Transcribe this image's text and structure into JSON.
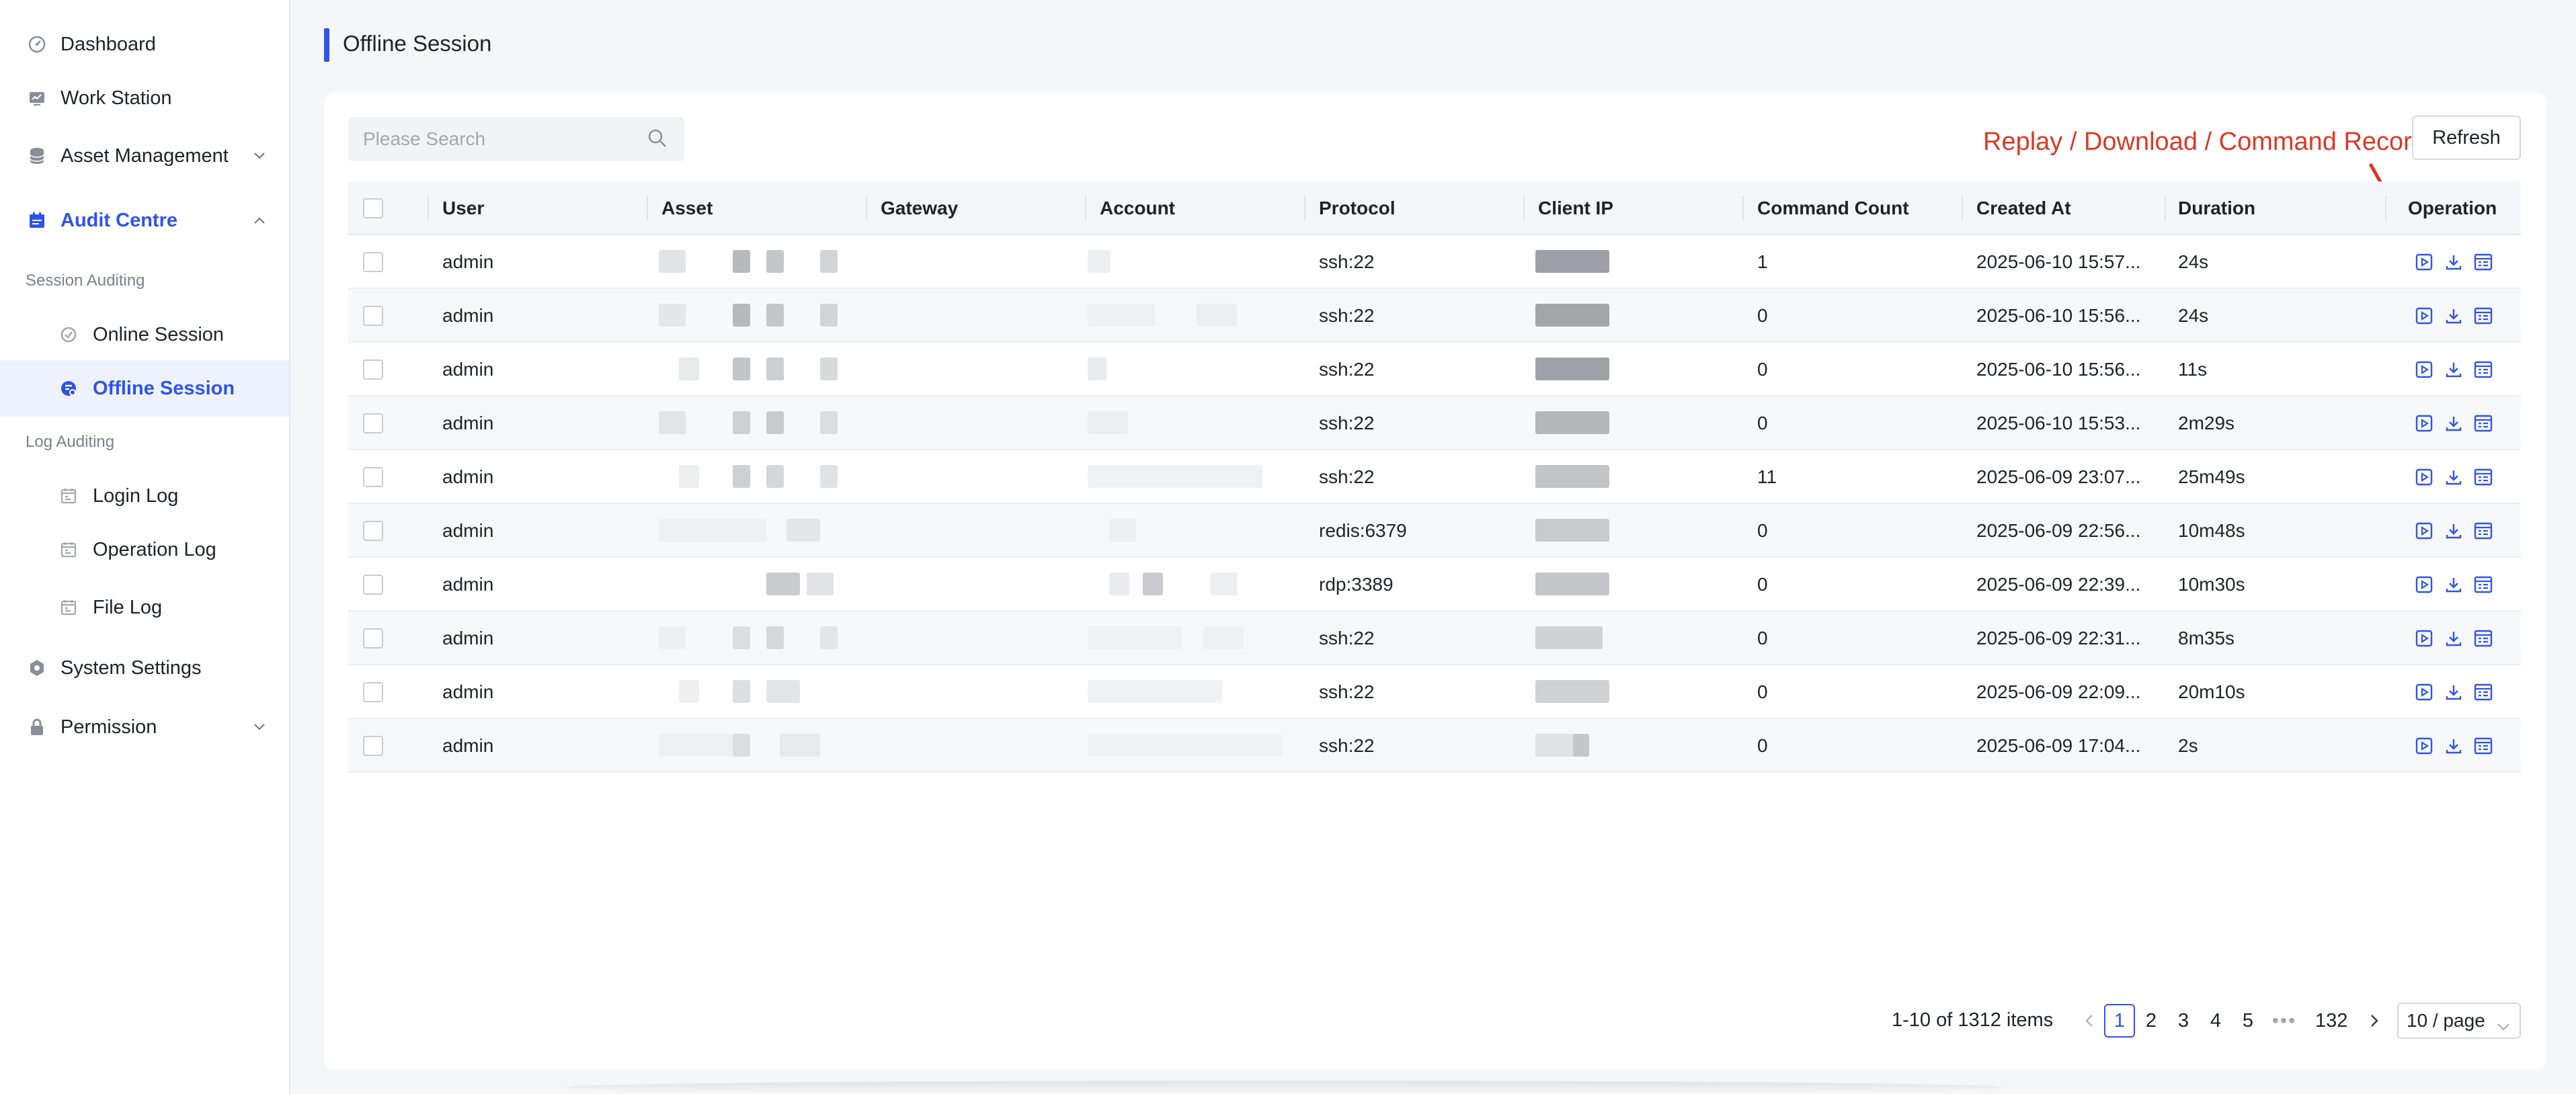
{
  "sidebar": {
    "items": [
      {
        "label": "Dashboard",
        "icon": "dashboard-icon"
      },
      {
        "label": "Work Station",
        "icon": "monitor-icon"
      },
      {
        "label": "Asset Management",
        "icon": "database-icon"
      },
      {
        "label": "Audit Centre",
        "icon": "calendar-icon"
      },
      {
        "label": "System Settings",
        "icon": "gear-icon"
      },
      {
        "label": "Permission",
        "icon": "lock-icon"
      }
    ],
    "groups": {
      "session_auditing": "Session Auditing",
      "log_auditing": "Log Auditing"
    },
    "sub_items": [
      {
        "label": "Online Session"
      },
      {
        "label": "Offline Session"
      },
      {
        "label": "Login Log"
      },
      {
        "label": "Operation Log"
      },
      {
        "label": "File Log"
      }
    ]
  },
  "page": {
    "title": "Offline Session"
  },
  "toolbar": {
    "search_placeholder": "Please Search",
    "refresh_label": "Refresh",
    "annotation": "Replay / Download / Command Record"
  },
  "table": {
    "columns": [
      "User",
      "Asset",
      "Gateway",
      "Account",
      "Protocol",
      "Client IP",
      "Command Count",
      "Created At",
      "Duration",
      "Operation"
    ],
    "rows": [
      {
        "user": "admin",
        "protocol": "ssh:22",
        "command_count": "1",
        "created_at": "2025-06-10 15:57...",
        "duration": "24s"
      },
      {
        "user": "admin",
        "protocol": "ssh:22",
        "command_count": "0",
        "created_at": "2025-06-10 15:56...",
        "duration": "24s"
      },
      {
        "user": "admin",
        "protocol": "ssh:22",
        "command_count": "0",
        "created_at": "2025-06-10 15:56...",
        "duration": "11s"
      },
      {
        "user": "admin",
        "protocol": "ssh:22",
        "command_count": "0",
        "created_at": "2025-06-10 15:53...",
        "duration": "2m29s"
      },
      {
        "user": "admin",
        "protocol": "ssh:22",
        "command_count": "11",
        "created_at": "2025-06-09 23:07...",
        "duration": "25m49s"
      },
      {
        "user": "admin",
        "protocol": "redis:6379",
        "command_count": "0",
        "created_at": "2025-06-09 22:56...",
        "duration": "10m48s"
      },
      {
        "user": "admin",
        "protocol": "rdp:3389",
        "command_count": "0",
        "created_at": "2025-06-09 22:39...",
        "duration": "10m30s"
      },
      {
        "user": "admin",
        "protocol": "ssh:22",
        "command_count": "0",
        "created_at": "2025-06-09 22:31...",
        "duration": "8m35s"
      },
      {
        "user": "admin",
        "protocol": "ssh:22",
        "command_count": "0",
        "created_at": "2025-06-09 22:09...",
        "duration": "20m10s"
      },
      {
        "user": "admin",
        "protocol": "ssh:22",
        "command_count": "0",
        "created_at": "2025-06-09 17:04...",
        "duration": "2s"
      }
    ],
    "operation_icons": [
      "replay-icon",
      "download-icon",
      "command-record-icon"
    ]
  },
  "pagination": {
    "total_text": "1-10 of 1312 items",
    "pages": [
      "1",
      "2",
      "3",
      "4",
      "5"
    ],
    "ellipsis": "•••",
    "last_page": "132",
    "current": "1",
    "page_size": "10 / page"
  },
  "colors": {
    "accent": "#2f54eb",
    "annotation": "#d93a26",
    "operation_icon": "#2f54eb"
  }
}
